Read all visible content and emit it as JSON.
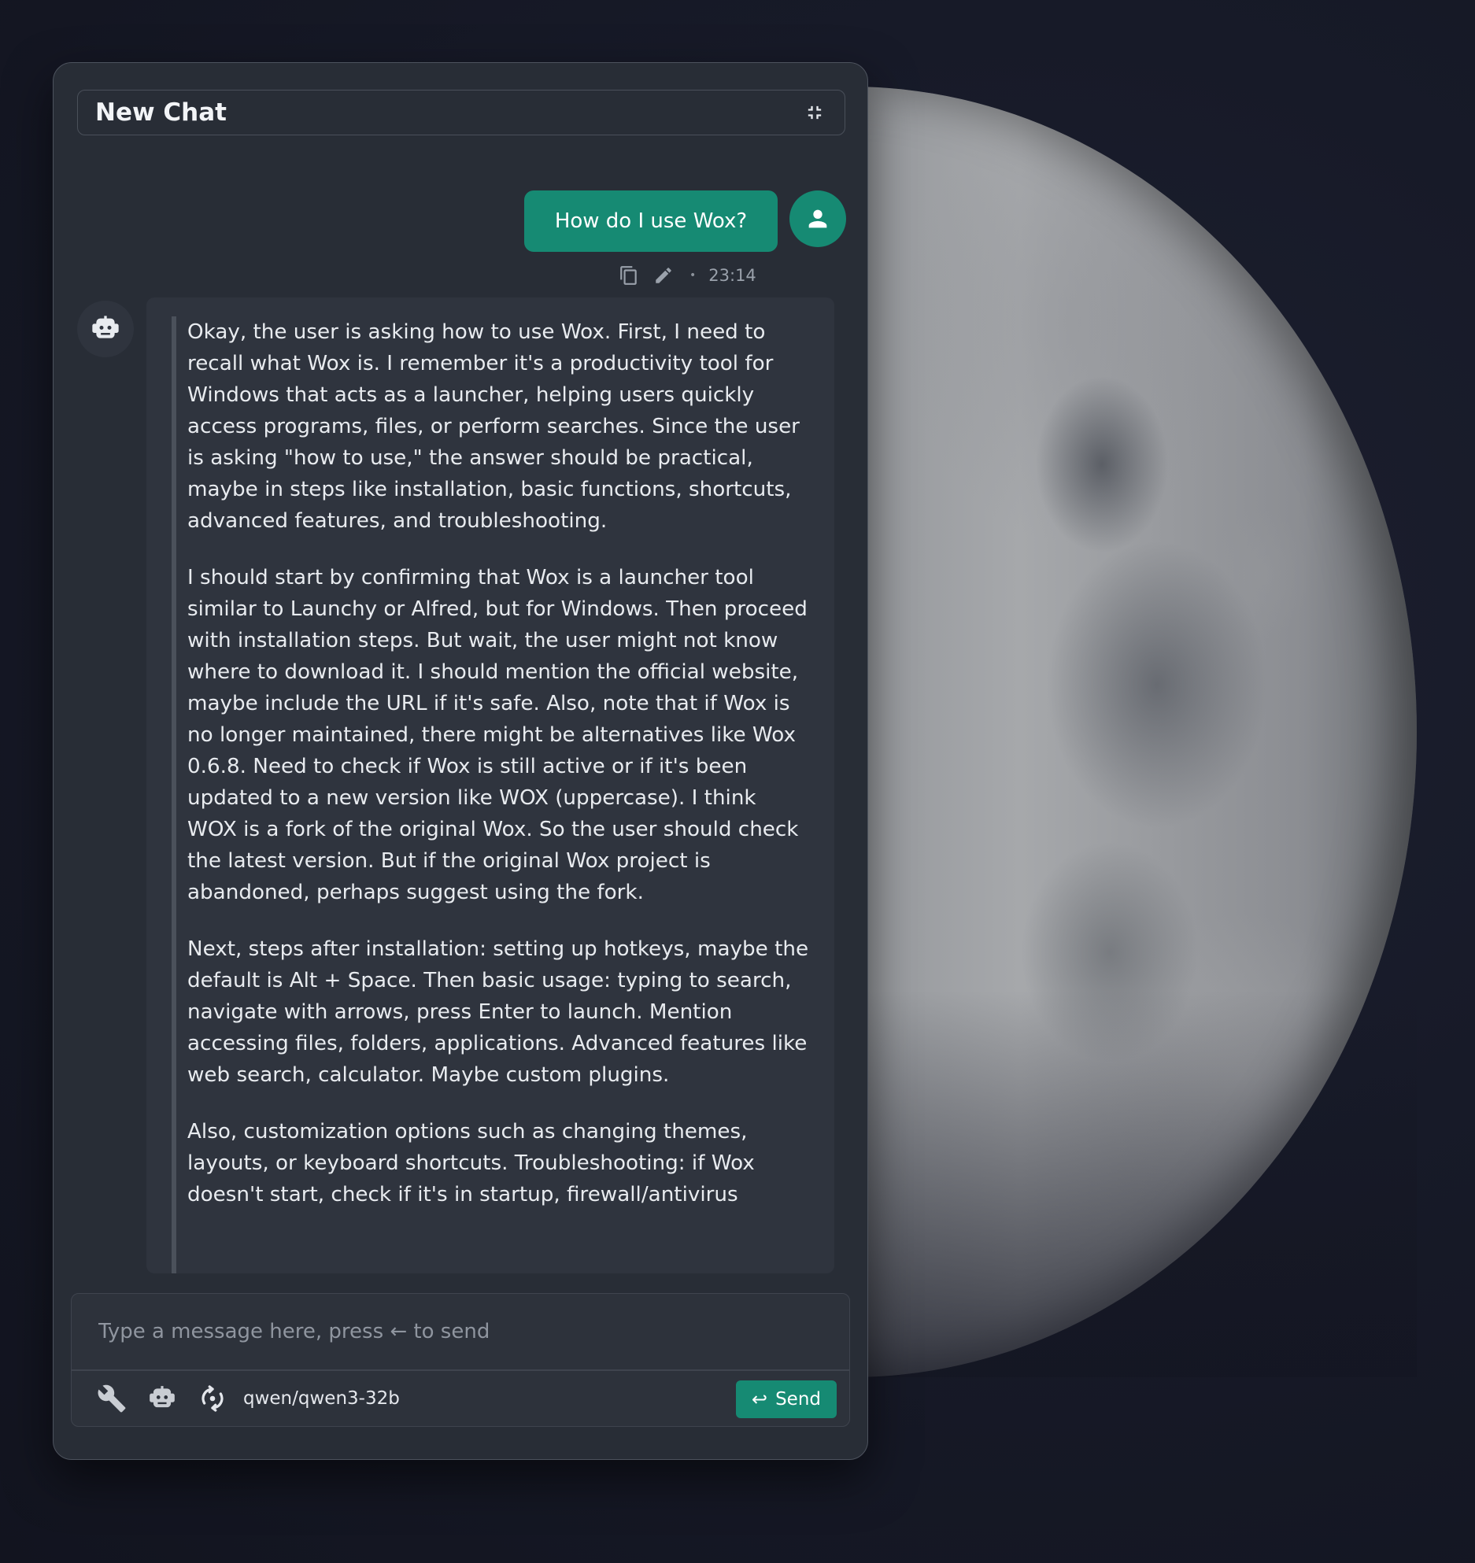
{
  "window": {
    "title": "New Chat"
  },
  "conversation": {
    "user_message": {
      "text": "How do I use Wox?",
      "time": "23:14",
      "separator": "•"
    },
    "assistant_message": {
      "paragraphs": [
        "Okay, the user is asking how to use Wox. First, I need to recall what Wox is. I remember it's a productivity tool for Windows that acts as a launcher, helping users quickly access programs, files, or perform searches. Since the user is asking \"how to use,\" the answer should be practical, maybe in steps like installation, basic functions, shortcuts, advanced features, and troubleshooting.",
        "I should start by confirming that Wox is a launcher tool similar to Launchy or Alfred, but for Windows. Then proceed with installation steps. But wait, the user might not know where to download it. I should mention the official website, maybe include the URL if it's safe. Also, note that if Wox is no longer maintained, there might be alternatives like Wox 0.6.8. Need to check if Wox is still active or if it's been updated to a new version like WOX (uppercase). I think WOX is a fork of the original Wox. So the user should check the latest version. But if the original Wox project is abandoned, perhaps suggest using the fork.",
        "Next, steps after installation: setting up hotkeys, maybe the default is Alt + Space. Then basic usage: typing to search, navigate with arrows, press Enter to launch. Mention accessing files, folders, applications. Advanced features like web search, calculator. Maybe custom plugins.",
        "Also, customization options such as changing themes, layouts, or keyboard shortcuts. Troubleshooting: if Wox doesn't start, check if it's in startup, firewall/antivirus"
      ]
    }
  },
  "composer": {
    "placeholder": "Type a message here, press ← to send",
    "model": "qwen/qwen3-32b",
    "send_label": "Send",
    "send_glyph": "↩"
  },
  "colors": {
    "accent": "#168a73",
    "window_bg": "#282d36",
    "bubble_bg": "#2f343e"
  },
  "icons": [
    "collapse-icon",
    "user-icon",
    "copy-icon",
    "edit-icon",
    "robot-icon",
    "wrench-icon",
    "model-switch-icon"
  ]
}
